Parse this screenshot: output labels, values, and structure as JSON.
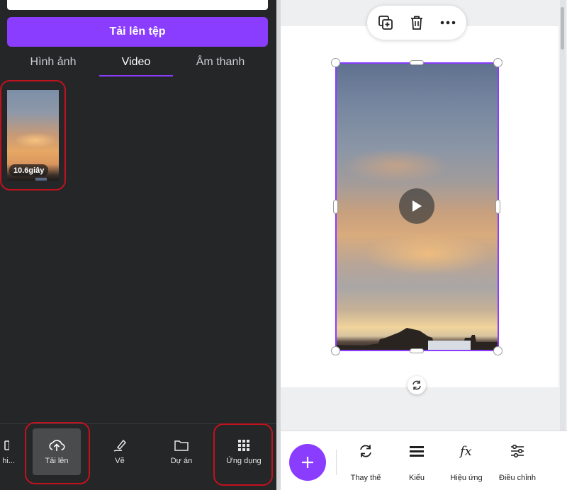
{
  "left_panel": {
    "upload_button": "Tải lên tệp",
    "tabs": [
      {
        "label": "Hình ảnh",
        "active": false
      },
      {
        "label": "Video",
        "active": true
      },
      {
        "label": "Âm thanh",
        "active": false
      }
    ],
    "media": [
      {
        "duration": "10.6giây"
      }
    ],
    "bottom_nav": [
      {
        "label": "...g hi...",
        "icon": "grid-icon"
      },
      {
        "label": "Tải lên",
        "icon": "cloud-upload-icon",
        "active": true
      },
      {
        "label": "Vẽ",
        "icon": "pen-icon"
      },
      {
        "label": "Dự án",
        "icon": "folder-icon"
      },
      {
        "label": "Ứng dụng",
        "icon": "apps-grid-icon"
      }
    ]
  },
  "canvas": {
    "float_toolbar": [
      "duplicate-icon",
      "delete-icon",
      "more-icon"
    ],
    "element": "video"
  },
  "bottom_toolbar": {
    "add_icon": "plus-icon",
    "items": [
      {
        "label": "Thay thế",
        "icon": "replace-icon"
      },
      {
        "label": "Kiểu",
        "icon": "style-icon"
      },
      {
        "label": "Hiệu ứng",
        "icon": "effects-icon"
      },
      {
        "label": "Điều chỉnh",
        "icon": "adjust-icon"
      }
    ]
  },
  "colors": {
    "accent": "#8b3dff",
    "panel_bg": "#252627",
    "highlight_ring": "#c1121f"
  }
}
